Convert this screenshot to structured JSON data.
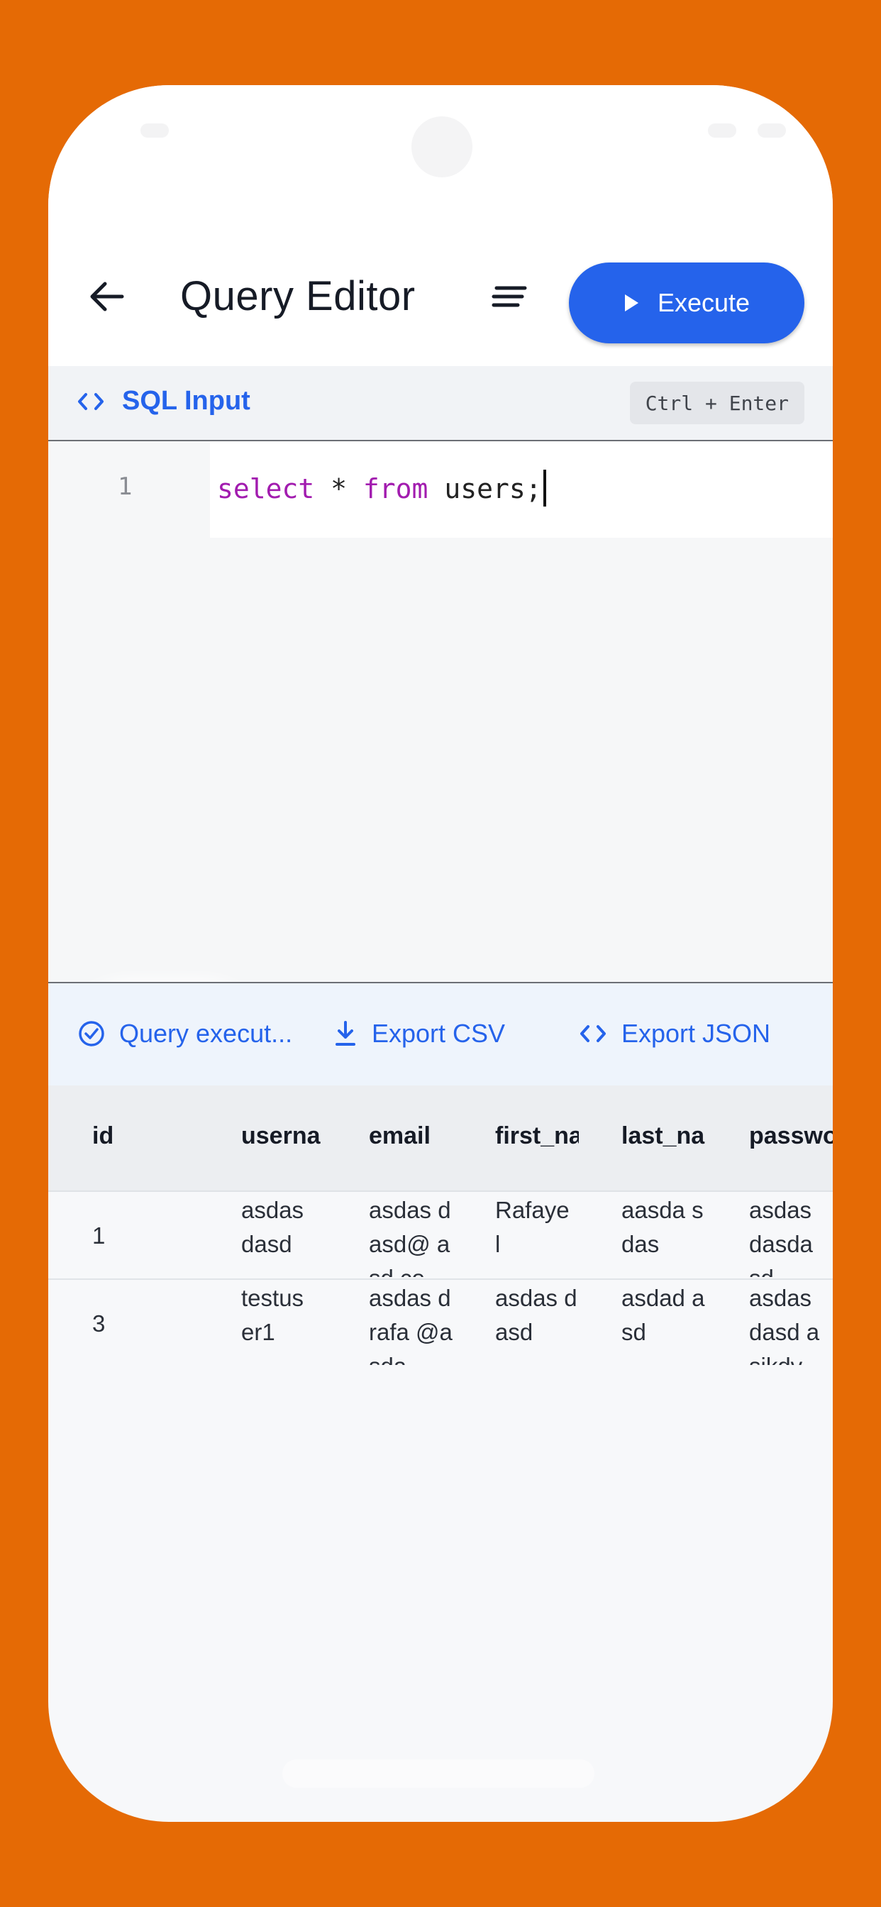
{
  "appbar": {
    "back_icon": "arrow-left-icon",
    "title": "Query Editor",
    "format_icon": "format-lines-icon",
    "execute_label": "Execute",
    "execute_icon": "play-icon"
  },
  "sql_input": {
    "label": "SQL Input",
    "icon": "code-icon",
    "shortcut": "Ctrl + Enter"
  },
  "editor": {
    "line_number": "1",
    "tokens": [
      "select",
      " * ",
      "from",
      " users;"
    ]
  },
  "result_bar": {
    "status": "Query execut...",
    "status_icon": "check-circle-icon",
    "export_csv": "Export CSV",
    "export_csv_icon": "download-icon",
    "export_json": "Export JSON",
    "export_json_icon": "code-icon"
  },
  "table": {
    "headers": [
      "id",
      "userna",
      "email",
      "first_na",
      "last_na",
      "passwo"
    ],
    "rows": [
      [
        "1",
        "asdas dasd",
        "asdas dasd@ asd.co",
        "Rafaye l",
        "aasda sdas",
        "asdas dasda sd"
      ],
      [
        "3",
        "testus er1",
        "asdas drafa @asda",
        "asdas dasd",
        "asdad asd",
        "asdas dasd asikdv"
      ]
    ]
  },
  "colors": {
    "accent": "#2563eb",
    "background": "#e56a05",
    "keyword": "#a21caf"
  }
}
